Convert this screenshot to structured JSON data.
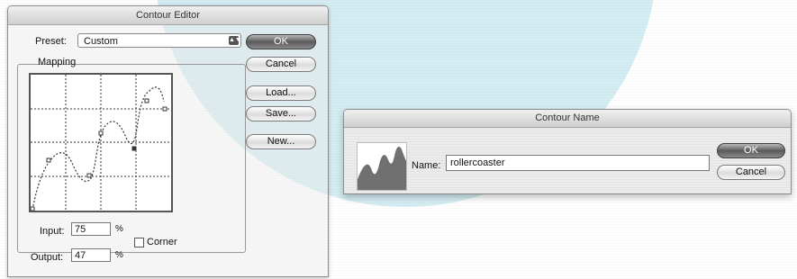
{
  "contour_editor": {
    "title": "Contour Editor",
    "preset_label": "Preset:",
    "preset_value": "Custom",
    "mapping_label": "Mapping",
    "input_label": "Input:",
    "input_value": "75",
    "input_unit": "%",
    "output_label": "Output:",
    "output_value": "47",
    "output_unit": "%",
    "corner_label": "Corner",
    "corner_checked": false,
    "buttons": {
      "ok": "OK",
      "cancel": "Cancel",
      "load": "Load...",
      "save": "Save...",
      "new": "New..."
    }
  },
  "contour_name": {
    "title": "Contour Name",
    "name_label": "Name:",
    "name_value": "rollercoaster",
    "buttons": {
      "ok": "OK",
      "cancel": "Cancel"
    }
  },
  "colors": {
    "background_circle": "#d4edf3",
    "default_button": "#5a5a5a",
    "preview_fill": "#707070"
  }
}
